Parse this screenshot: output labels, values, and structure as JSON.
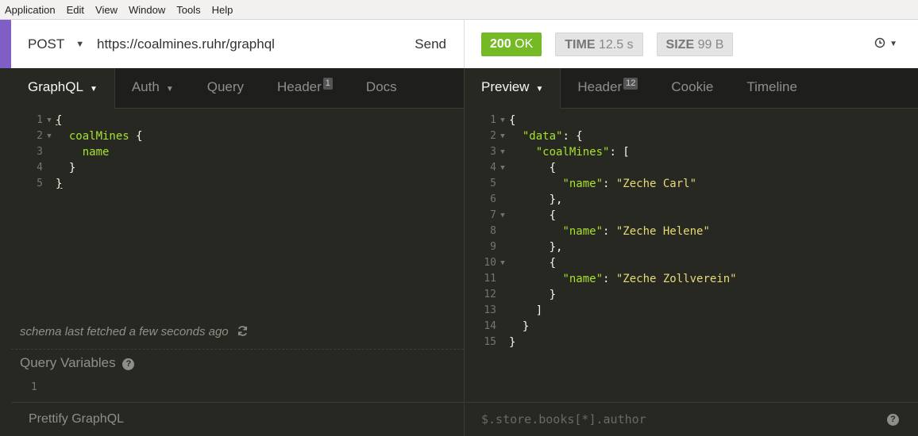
{
  "menu": [
    "Application",
    "Edit",
    "View",
    "Window",
    "Tools",
    "Help"
  ],
  "request": {
    "method": "POST",
    "url": "https://coalmines.ruhr/graphql",
    "send_label": "Send"
  },
  "response": {
    "status_code": "200",
    "status_text": "OK",
    "time_label": "TIME",
    "time_value": "12.5 s",
    "size_label": "SIZE",
    "size_value": "99 B"
  },
  "left_tabs": {
    "graphql": "GraphQL",
    "auth": "Auth",
    "query": "Query",
    "header": "Header",
    "header_count": "1",
    "docs": "Docs"
  },
  "right_tabs": {
    "preview": "Preview",
    "header": "Header",
    "header_count": "12",
    "cookie": "Cookie",
    "timeline": "Timeline"
  },
  "editor": {
    "schema_note": "schema last fetched a few seconds ago",
    "query_variables_title": "Query Variables",
    "query_variables_line": "1",
    "prettify_label": "Prettify GraphQL"
  },
  "preview": {
    "filter_placeholder": "$.store.books[*].author"
  },
  "colors": {
    "accent": "#7f5fc6",
    "status_ok": "#75ba24",
    "editor_bg": "#272822",
    "keyword": "#a6e22e",
    "string": "#e6db74"
  }
}
